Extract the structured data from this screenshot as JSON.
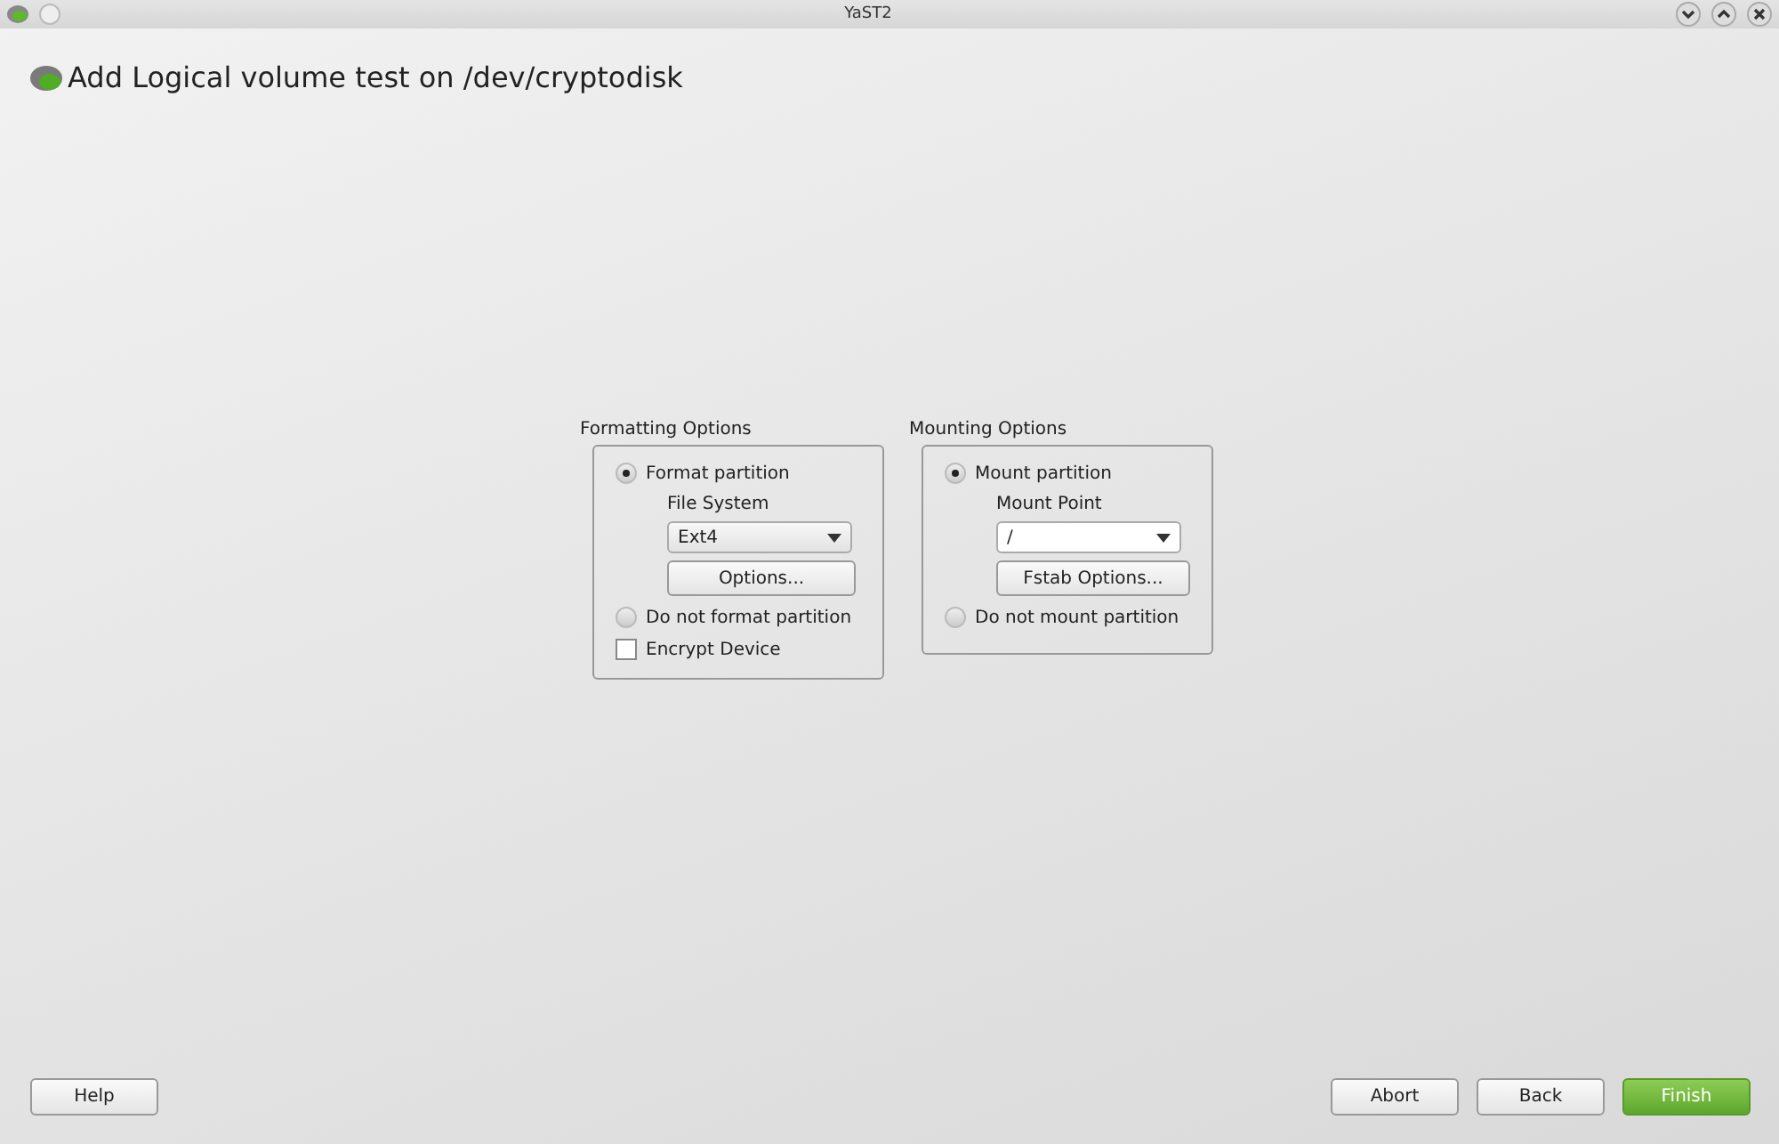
{
  "window": {
    "title": "YaST2"
  },
  "heading": "Add Logical volume test on /dev/cryptodisk",
  "formatting": {
    "title": "Formatting Options",
    "format_radio": {
      "label": "Format partition",
      "selected": true
    },
    "file_system": {
      "label": "File System",
      "value": "Ext4"
    },
    "options_button": "Options...",
    "no_format_radio": {
      "label": "Do not format partition",
      "selected": false
    },
    "encrypt": {
      "label": "Encrypt Device",
      "checked": false
    }
  },
  "mounting": {
    "title": "Mounting Options",
    "mount_radio": {
      "label": "Mount partition",
      "selected": true
    },
    "mount_point": {
      "label": "Mount Point",
      "value": "/"
    },
    "fstab_button": "Fstab Options...",
    "no_mount_radio": {
      "label": "Do not mount partition",
      "selected": false
    }
  },
  "buttons": {
    "help": "Help",
    "abort": "Abort",
    "back": "Back",
    "finish": "Finish"
  }
}
